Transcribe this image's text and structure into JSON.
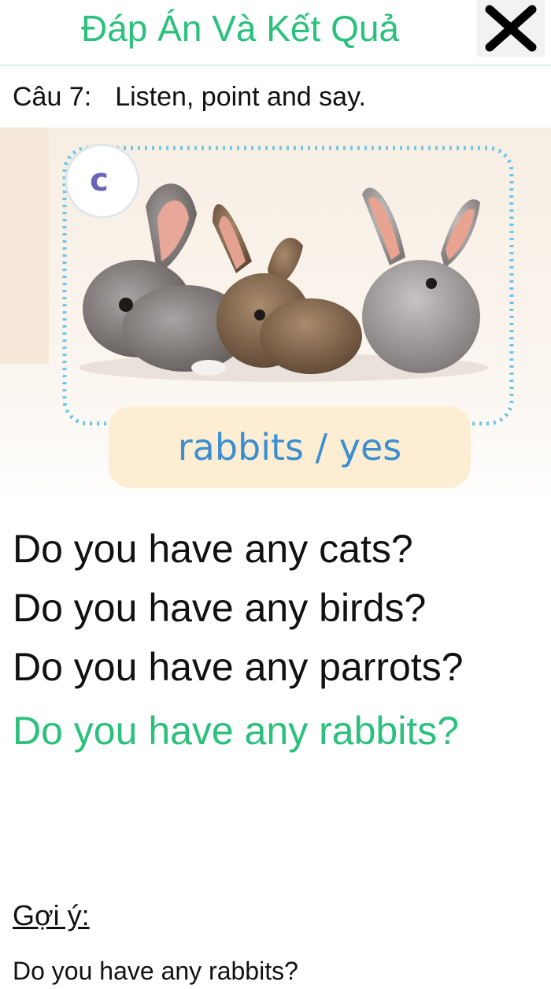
{
  "header": {
    "title": "Đáp Án Và Kết Quả",
    "close_icon": "close-icon"
  },
  "question": {
    "number": "Câu 7:",
    "instruction": "Listen, point and say."
  },
  "illustration": {
    "badge_letter": "c",
    "caption": "rabbits / yes",
    "colors": {
      "dotted_border": "#6cc4ea",
      "caption_bg": "#fdeed3",
      "caption_text": "#3b8fd0"
    }
  },
  "answers": [
    {
      "text": "Do you have any cats?",
      "correct": false
    },
    {
      "text": "Do you have any birds?",
      "correct": false
    },
    {
      "text": "Do you have any parrots?",
      "correct": false
    },
    {
      "text": "Do you have any rabbits?",
      "correct": true
    }
  ],
  "hint": {
    "label": "Gợi ý:",
    "text": "Do you have any rabbits?"
  },
  "colors": {
    "accent": "#2bc07c"
  }
}
